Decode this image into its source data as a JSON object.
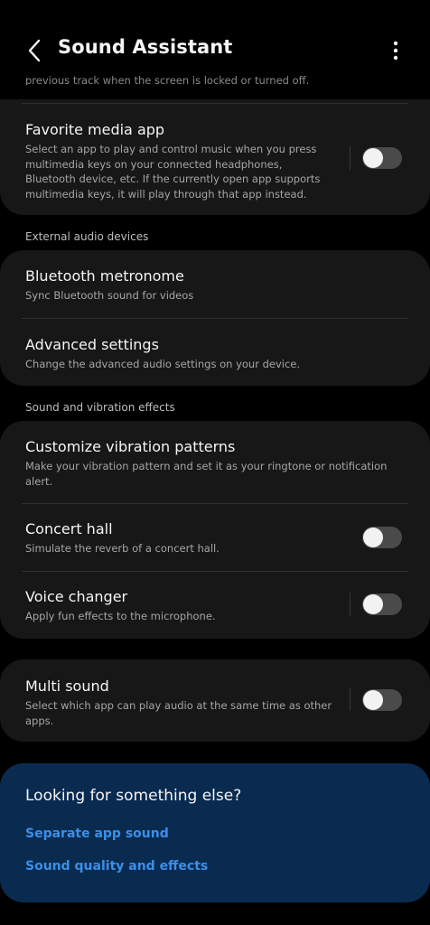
{
  "header": {
    "title": "Sound Assistant",
    "back_icon": "chevron-left-icon",
    "more_icon": "more-vertical-icon"
  },
  "partial_text": "previous track when the screen is locked or turned off.",
  "favorite_media_app": {
    "title": "Favorite media app",
    "subtitle": "Select an app to play and control music when you press multimedia keys on your connected headphones, Bluetooth device, etc. If the currently open app supports multimedia keys, it will play through that app instead.",
    "toggle_on": false
  },
  "external_audio_header": "External audio devices",
  "bluetooth_metronome": {
    "title": "Bluetooth metronome",
    "subtitle": "Sync Bluetooth sound for videos"
  },
  "advanced_settings": {
    "title": "Advanced settings",
    "subtitle": "Change the advanced audio settings on your device."
  },
  "sound_vibration_header": "Sound and vibration effects",
  "customize_vibration": {
    "title": "Customize vibration patterns",
    "subtitle": "Make your vibration pattern and set it as your ringtone or notification alert."
  },
  "concert_hall": {
    "title": "Concert hall",
    "subtitle": "Simulate the reverb of a concert hall.",
    "toggle_on": false
  },
  "voice_changer": {
    "title": "Voice changer",
    "subtitle": "Apply fun effects to the microphone.",
    "toggle_on": false
  },
  "multi_sound": {
    "title": "Multi sound",
    "subtitle": "Select which app can play audio at the same time as other apps.",
    "toggle_on": false
  },
  "looking": {
    "title": "Looking for something else?",
    "links": [
      "Separate app sound",
      "Sound quality and effects"
    ]
  },
  "colors": {
    "background": "#000000",
    "card": "#171717",
    "accent_panel": "#0a2b50",
    "link": "#3b8fe8"
  }
}
